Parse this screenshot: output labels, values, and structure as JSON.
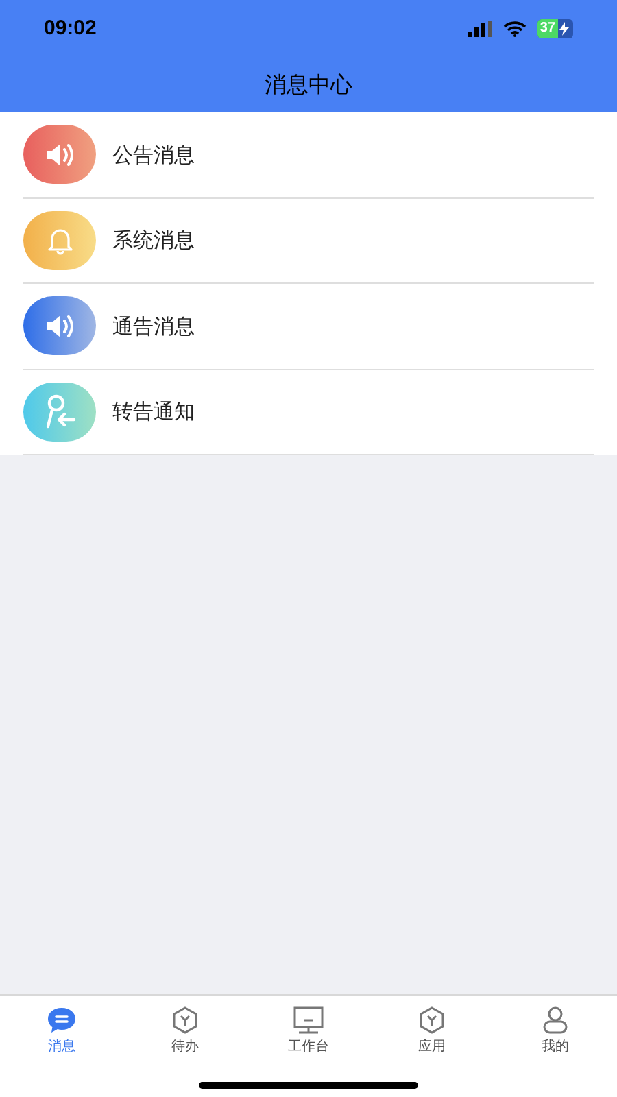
{
  "status_bar": {
    "time": "09:02",
    "battery": "37"
  },
  "header": {
    "title": "消息中心"
  },
  "items": [
    {
      "label": "公告消息",
      "kind": "speaker",
      "color": "#e8605e"
    },
    {
      "label": "系统消息",
      "kind": "bell",
      "color": "#f2b04a"
    },
    {
      "label": "通告消息",
      "kind": "speaker",
      "color": "#2f6ee8"
    },
    {
      "label": "转告通知",
      "kind": "forward",
      "color": "#4fc9ea"
    }
  ],
  "tabs": [
    {
      "label": "消息",
      "kind": "chat",
      "selected": true
    },
    {
      "label": "待办",
      "kind": "hex",
      "selected": false
    },
    {
      "label": "工作台",
      "kind": "monitor",
      "selected": false
    },
    {
      "label": "应用",
      "kind": "hex",
      "selected": false
    },
    {
      "label": "我的",
      "kind": "user",
      "selected": false
    }
  ]
}
